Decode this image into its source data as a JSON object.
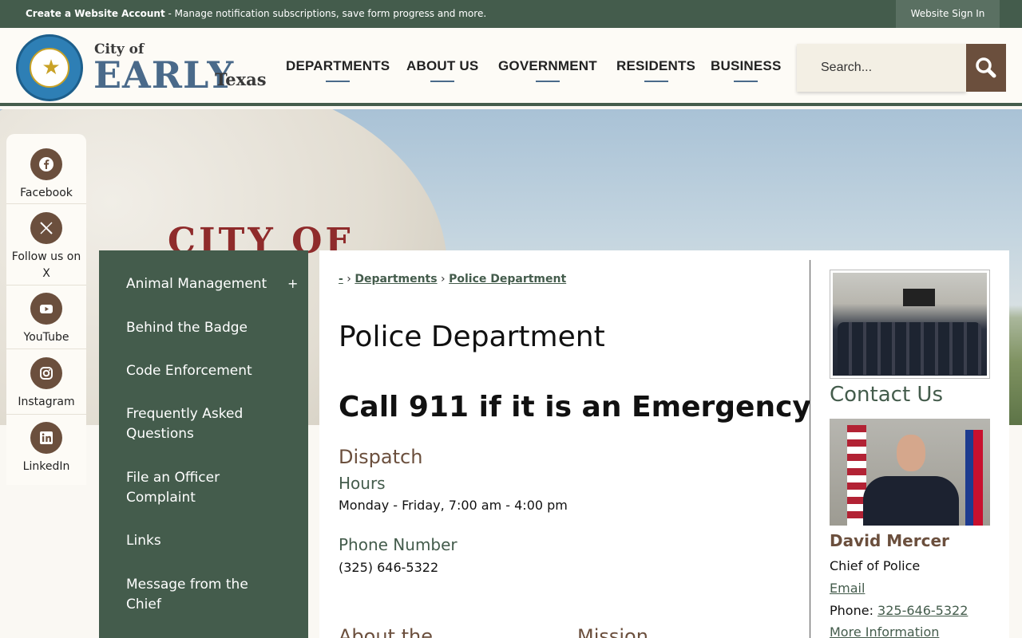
{
  "topbar": {
    "account_bold": "Create a Website Account",
    "account_rest": " - Manage notification subscriptions, save form progress and more.",
    "signin": "Website Sign In"
  },
  "logo": {
    "city_of": "City of",
    "early": "EARLY",
    "texas": "Texas",
    "seal_icon": "city-seal-icon"
  },
  "nav": {
    "items": [
      "DEPARTMENTS",
      "ABOUT US",
      "GOVERNMENT",
      "RESIDENTS",
      "BUSINESS"
    ]
  },
  "search": {
    "placeholder": "Search...",
    "button_icon": "search-icon"
  },
  "social": [
    {
      "label": "Facebook",
      "icon": "facebook-icon"
    },
    {
      "label": "Follow us on X",
      "icon": "x-icon"
    },
    {
      "label": "YouTube",
      "icon": "youtube-icon"
    },
    {
      "label": "Instagram",
      "icon": "instagram-icon"
    },
    {
      "label": "LinkedIn",
      "icon": "linkedin-icon"
    }
  ],
  "hero": {
    "tower_text": "CITY OF"
  },
  "sidemenu": {
    "items": [
      "Animal Management",
      "Behind the Badge",
      "Code Enforcement",
      "Frequently Asked Questions",
      "File an Officer Complaint",
      "Links",
      "Message from the Chief"
    ],
    "expand_symbol": "+"
  },
  "breadcrumb": {
    "home": "-",
    "sep": "›",
    "departments": "Departments",
    "current": "Police Department"
  },
  "main": {
    "title": "Police Department",
    "emergency": "Call 911 if it is an Emergency",
    "dispatch_heading": "Dispatch",
    "hours_heading": "Hours",
    "hours_text": "Monday - Friday, 7:00 am - 4:00 pm",
    "phone_heading": "Phone Number",
    "phone_text": "(325) 646-5322",
    "about_heading": "About the",
    "mission_heading": "Mission"
  },
  "contact": {
    "heading": "Contact Us",
    "name": "David Mercer",
    "title": "Chief of Police",
    "email_label": "Email",
    "phone_label": "Phone: ",
    "phone_value": "325-646-5322",
    "more_info": "More Information"
  },
  "colors": {
    "primary_green": "#445c4c",
    "brown_accent": "#6b4f3d",
    "logo_blue": "#4a6a8a"
  }
}
